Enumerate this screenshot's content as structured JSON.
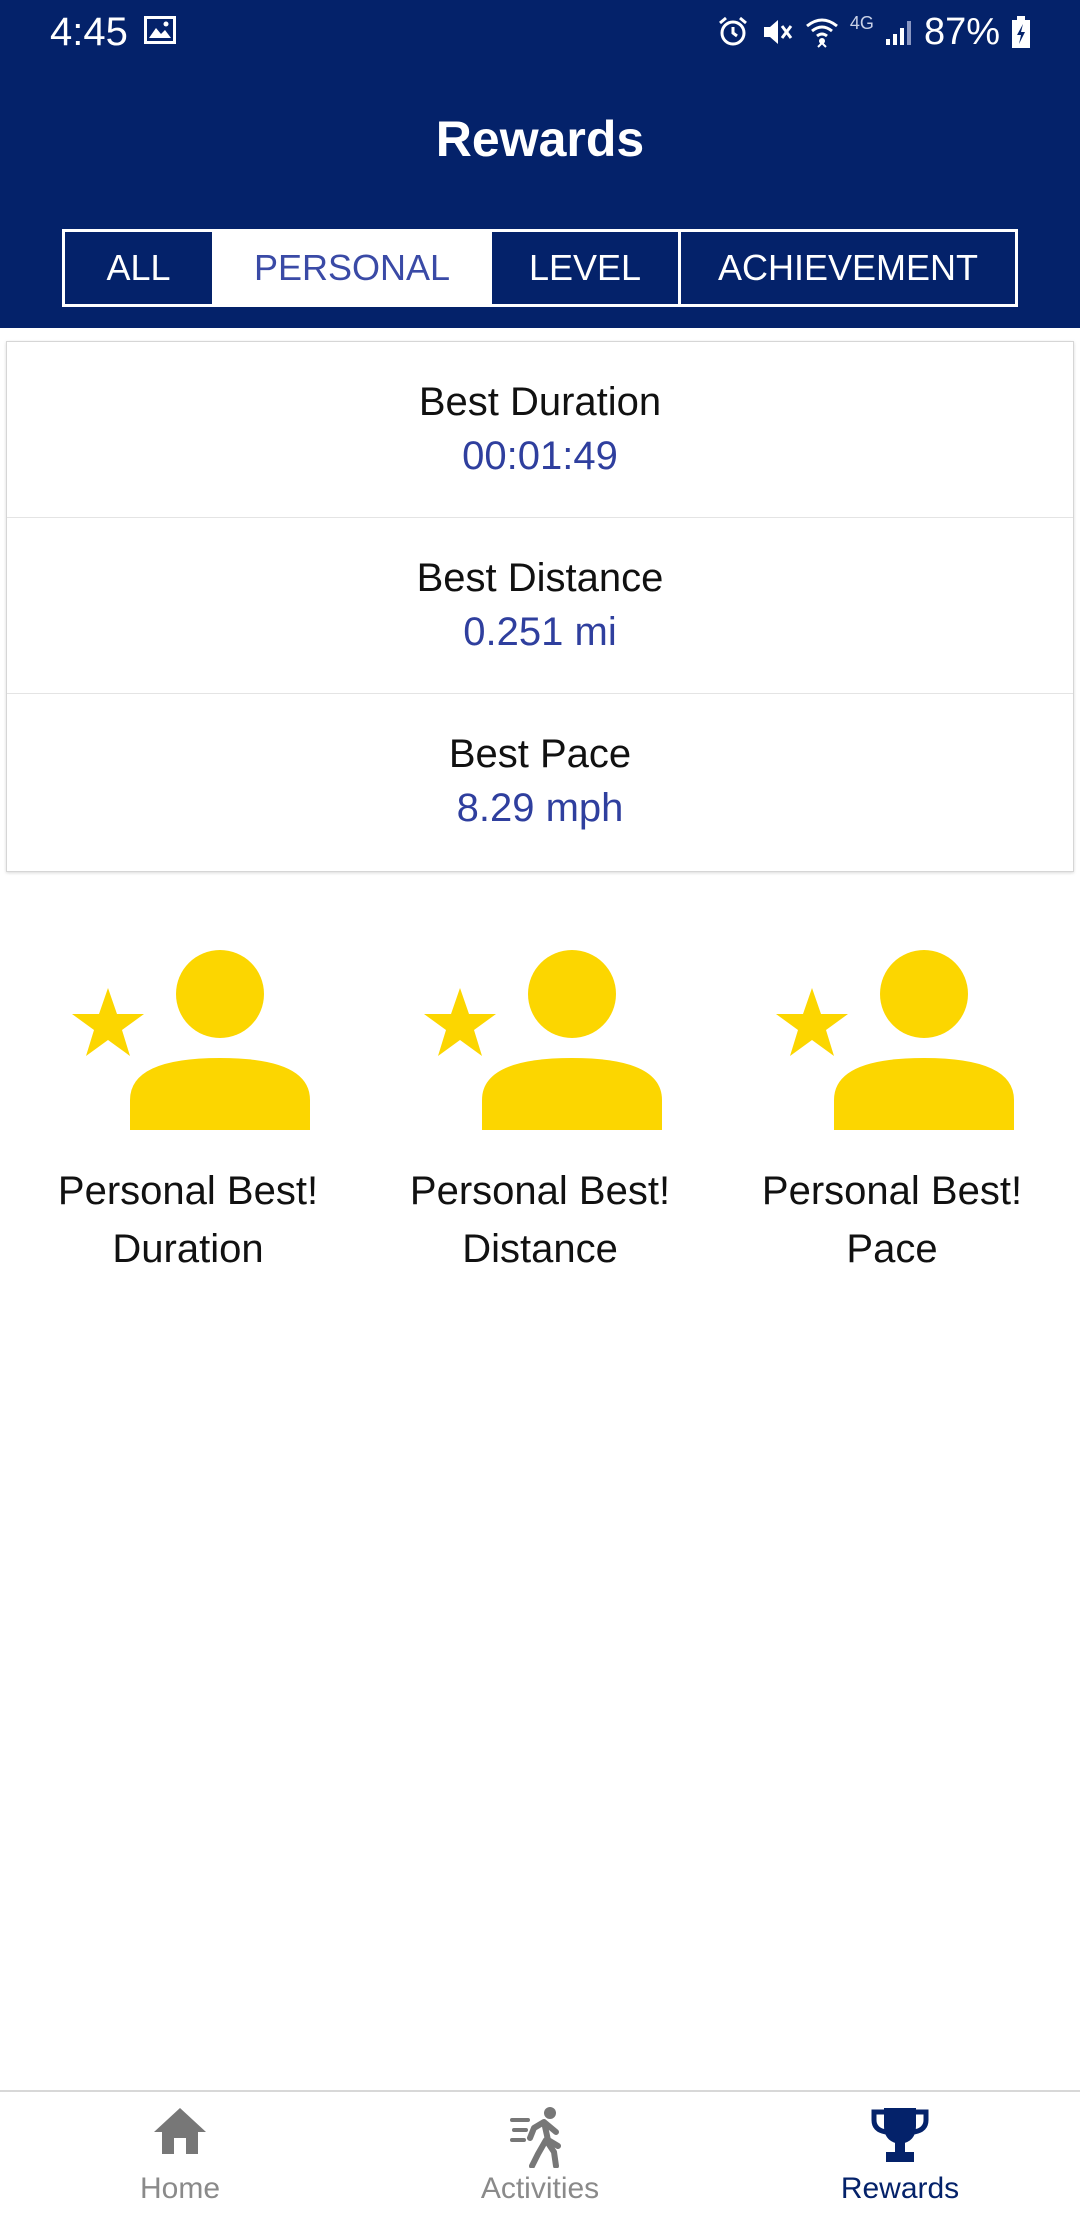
{
  "status_bar": {
    "time": "4:45",
    "network": "4G",
    "battery": "87%"
  },
  "header": {
    "title": "Rewards",
    "background_color": "#04226a"
  },
  "tabs": [
    {
      "label": "ALL",
      "active": false
    },
    {
      "label": "PERSONAL",
      "active": true
    },
    {
      "label": "LEVEL",
      "active": false
    },
    {
      "label": "ACHIEVEMENT",
      "active": false
    }
  ],
  "stats": [
    {
      "label": "Best Duration",
      "value": "00:01:49"
    },
    {
      "label": "Best Distance",
      "value": "0.251 mi"
    },
    {
      "label": "Best Pace",
      "value": "8.29 mph"
    }
  ],
  "badges": [
    {
      "line1": "Personal Best!",
      "line2": "Duration",
      "icon": "person-star-icon"
    },
    {
      "line1": "Personal Best!",
      "line2": "Distance",
      "icon": "person-star-icon"
    },
    {
      "line1": "Personal Best!",
      "line2": "Pace",
      "icon": "person-star-icon"
    }
  ],
  "badge_color": "#fcd600",
  "value_color": "#2f3f9e",
  "bottom_nav": [
    {
      "label": "Home",
      "icon": "home-icon",
      "active": false
    },
    {
      "label": "Activities",
      "icon": "running-person-icon",
      "active": false
    },
    {
      "label": "Rewards",
      "icon": "trophy-icon",
      "active": true
    }
  ]
}
